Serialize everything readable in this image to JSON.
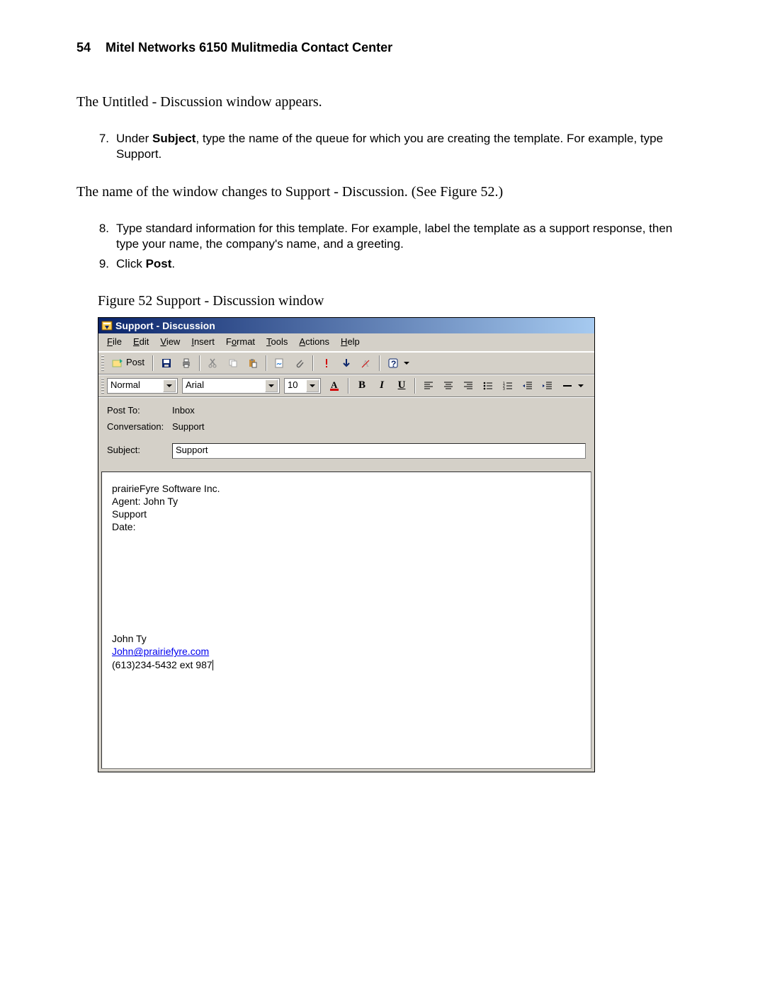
{
  "header": {
    "page_number": "54",
    "title": "Mitel Networks 6150 Mulitmedia Contact Center"
  },
  "paragraphs": {
    "intro": "The Untitled - Discussion window appears.",
    "after7": "The name of the window changes to Support - Discussion. (See Figure 52.)"
  },
  "steps": {
    "s7": "Under Subject, type the name of the queue for which you are creating the template. For example, type Support.",
    "s7_prefix": "Under ",
    "s7_bold": "Subject",
    "s7_suffix": ", type the name of the queue for which you are creating the template. For example, type Support.",
    "s8": "Type standard information for this template. For example, label the template as a support response, then type your name, the company's name, and a greeting.",
    "s9_prefix": "Click ",
    "s9_bold": "Post",
    "s9_suffix": "."
  },
  "figure": {
    "caption": "Figure 52   Support - Discussion window"
  },
  "window": {
    "title": "Support - Discussion",
    "menu": {
      "file": "File",
      "edit": "Edit",
      "view": "View",
      "insert": "Insert",
      "format": "Format",
      "tools": "Tools",
      "actions": "Actions",
      "help": "Help"
    },
    "toolbar": {
      "post_label": "Post"
    },
    "format_row": {
      "style": "Normal",
      "font": "Arial",
      "size": "10"
    },
    "fields": {
      "post_to_label": "Post To:",
      "post_to_value": "Inbox",
      "conversation_label": "Conversation:",
      "conversation_value": "Support",
      "subject_label": "Subject:",
      "subject_value": "Support"
    },
    "body": {
      "line1": "prairieFyre Software Inc.",
      "line2": "Agent: John Ty",
      "line3": "Support",
      "line4": "Date:",
      "sig_name": "John Ty",
      "sig_email": "John@prairiefyre.com",
      "sig_phone": "(613)234-5432 ext 987"
    }
  }
}
